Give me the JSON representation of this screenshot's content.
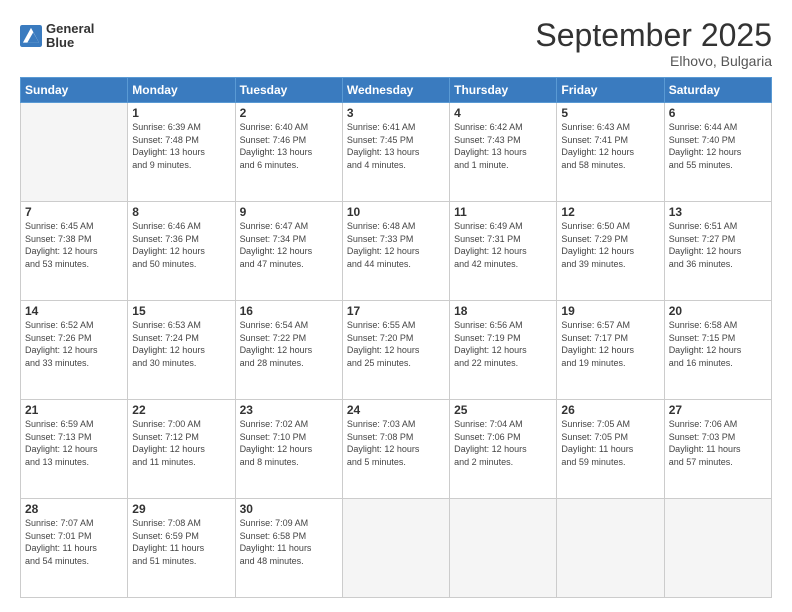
{
  "header": {
    "logo_line1": "General",
    "logo_line2": "Blue",
    "title": "September 2025",
    "subtitle": "Elhovo, Bulgaria"
  },
  "weekdays": [
    "Sunday",
    "Monday",
    "Tuesday",
    "Wednesday",
    "Thursday",
    "Friday",
    "Saturday"
  ],
  "weeks": [
    [
      {
        "day": "",
        "info": ""
      },
      {
        "day": "1",
        "info": "Sunrise: 6:39 AM\nSunset: 7:48 PM\nDaylight: 13 hours\nand 9 minutes."
      },
      {
        "day": "2",
        "info": "Sunrise: 6:40 AM\nSunset: 7:46 PM\nDaylight: 13 hours\nand 6 minutes."
      },
      {
        "day": "3",
        "info": "Sunrise: 6:41 AM\nSunset: 7:45 PM\nDaylight: 13 hours\nand 4 minutes."
      },
      {
        "day": "4",
        "info": "Sunrise: 6:42 AM\nSunset: 7:43 PM\nDaylight: 13 hours\nand 1 minute."
      },
      {
        "day": "5",
        "info": "Sunrise: 6:43 AM\nSunset: 7:41 PM\nDaylight: 12 hours\nand 58 minutes."
      },
      {
        "day": "6",
        "info": "Sunrise: 6:44 AM\nSunset: 7:40 PM\nDaylight: 12 hours\nand 55 minutes."
      }
    ],
    [
      {
        "day": "7",
        "info": "Sunrise: 6:45 AM\nSunset: 7:38 PM\nDaylight: 12 hours\nand 53 minutes."
      },
      {
        "day": "8",
        "info": "Sunrise: 6:46 AM\nSunset: 7:36 PM\nDaylight: 12 hours\nand 50 minutes."
      },
      {
        "day": "9",
        "info": "Sunrise: 6:47 AM\nSunset: 7:34 PM\nDaylight: 12 hours\nand 47 minutes."
      },
      {
        "day": "10",
        "info": "Sunrise: 6:48 AM\nSunset: 7:33 PM\nDaylight: 12 hours\nand 44 minutes."
      },
      {
        "day": "11",
        "info": "Sunrise: 6:49 AM\nSunset: 7:31 PM\nDaylight: 12 hours\nand 42 minutes."
      },
      {
        "day": "12",
        "info": "Sunrise: 6:50 AM\nSunset: 7:29 PM\nDaylight: 12 hours\nand 39 minutes."
      },
      {
        "day": "13",
        "info": "Sunrise: 6:51 AM\nSunset: 7:27 PM\nDaylight: 12 hours\nand 36 minutes."
      }
    ],
    [
      {
        "day": "14",
        "info": "Sunrise: 6:52 AM\nSunset: 7:26 PM\nDaylight: 12 hours\nand 33 minutes."
      },
      {
        "day": "15",
        "info": "Sunrise: 6:53 AM\nSunset: 7:24 PM\nDaylight: 12 hours\nand 30 minutes."
      },
      {
        "day": "16",
        "info": "Sunrise: 6:54 AM\nSunset: 7:22 PM\nDaylight: 12 hours\nand 28 minutes."
      },
      {
        "day": "17",
        "info": "Sunrise: 6:55 AM\nSunset: 7:20 PM\nDaylight: 12 hours\nand 25 minutes."
      },
      {
        "day": "18",
        "info": "Sunrise: 6:56 AM\nSunset: 7:19 PM\nDaylight: 12 hours\nand 22 minutes."
      },
      {
        "day": "19",
        "info": "Sunrise: 6:57 AM\nSunset: 7:17 PM\nDaylight: 12 hours\nand 19 minutes."
      },
      {
        "day": "20",
        "info": "Sunrise: 6:58 AM\nSunset: 7:15 PM\nDaylight: 12 hours\nand 16 minutes."
      }
    ],
    [
      {
        "day": "21",
        "info": "Sunrise: 6:59 AM\nSunset: 7:13 PM\nDaylight: 12 hours\nand 13 minutes."
      },
      {
        "day": "22",
        "info": "Sunrise: 7:00 AM\nSunset: 7:12 PM\nDaylight: 12 hours\nand 11 minutes."
      },
      {
        "day": "23",
        "info": "Sunrise: 7:02 AM\nSunset: 7:10 PM\nDaylight: 12 hours\nand 8 minutes."
      },
      {
        "day": "24",
        "info": "Sunrise: 7:03 AM\nSunset: 7:08 PM\nDaylight: 12 hours\nand 5 minutes."
      },
      {
        "day": "25",
        "info": "Sunrise: 7:04 AM\nSunset: 7:06 PM\nDaylight: 12 hours\nand 2 minutes."
      },
      {
        "day": "26",
        "info": "Sunrise: 7:05 AM\nSunset: 7:05 PM\nDaylight: 11 hours\nand 59 minutes."
      },
      {
        "day": "27",
        "info": "Sunrise: 7:06 AM\nSunset: 7:03 PM\nDaylight: 11 hours\nand 57 minutes."
      }
    ],
    [
      {
        "day": "28",
        "info": "Sunrise: 7:07 AM\nSunset: 7:01 PM\nDaylight: 11 hours\nand 54 minutes."
      },
      {
        "day": "29",
        "info": "Sunrise: 7:08 AM\nSunset: 6:59 PM\nDaylight: 11 hours\nand 51 minutes."
      },
      {
        "day": "30",
        "info": "Sunrise: 7:09 AM\nSunset: 6:58 PM\nDaylight: 11 hours\nand 48 minutes."
      },
      {
        "day": "",
        "info": ""
      },
      {
        "day": "",
        "info": ""
      },
      {
        "day": "",
        "info": ""
      },
      {
        "day": "",
        "info": ""
      }
    ]
  ]
}
